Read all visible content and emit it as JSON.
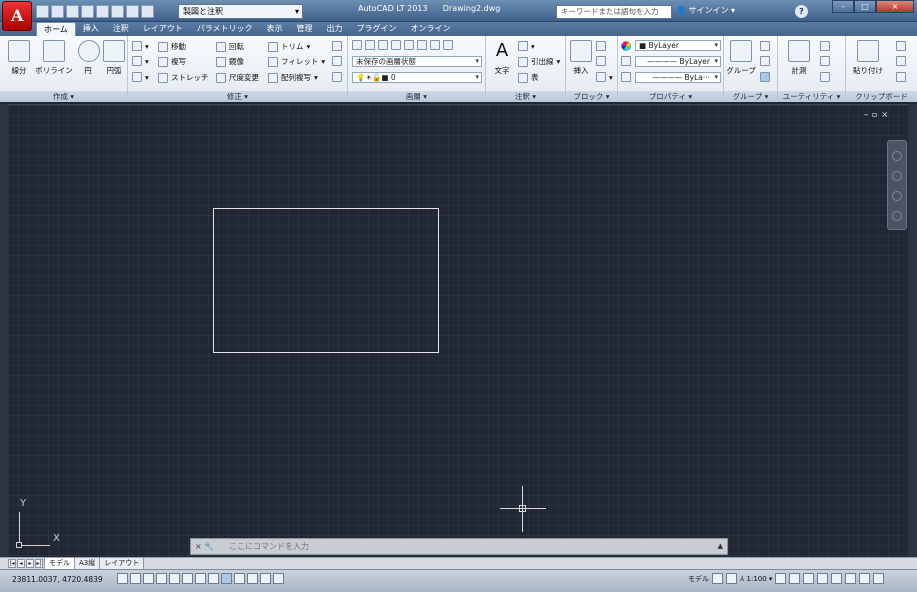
{
  "app": {
    "title": "AutoCAD LT 2013",
    "document": "Drawing2.dwg",
    "app_menu_letter": "A"
  },
  "workspace": {
    "value": "製図と注釈"
  },
  "search": {
    "placeholder": "キーワードまたは語句を入力"
  },
  "signin": {
    "label": "サインイン"
  },
  "help": {
    "label": "?"
  },
  "window_controls": {
    "minimize": "–",
    "maximize": "□",
    "close": "×"
  },
  "tabs": [
    "ホーム",
    "挿入",
    "注釈",
    "レイアウト",
    "パラメトリック",
    "表示",
    "管理",
    "出力",
    "プラグイン",
    "オンライン"
  ],
  "ribbon": {
    "draw": {
      "title": "作成 ▾",
      "line": "線分",
      "polyline": "ポリライン",
      "circle": "円",
      "arc": "円弧"
    },
    "modify": {
      "title": "修正 ▾",
      "move": "移動",
      "rotate": "回転",
      "trim": "トリム",
      "copy": "複写",
      "mirror": "鏡像",
      "fillet": "フィレット",
      "stretch": "ストレッチ",
      "scale": "尺度変更",
      "array": "配列複写"
    },
    "layers": {
      "title": "画層 ▾",
      "state": "未保存の画層状態",
      "current": "0"
    },
    "annotation": {
      "title": "注釈 ▾",
      "text": "文字",
      "leader": "引出線",
      "table": "表"
    },
    "block": {
      "title": "ブロック ▾",
      "insert": "挿入"
    },
    "properties": {
      "title": "プロパティ ▾",
      "color": "ByLayer",
      "linetype": "ByLayer",
      "lineweight": "ByLa···"
    },
    "groups": {
      "title": "グループ ▾",
      "group": "グループ"
    },
    "utilities": {
      "title": "ユーティリティ ▾",
      "measure": "計測"
    },
    "clipboard": {
      "title": "クリップボード",
      "paste": "貼り付け"
    }
  },
  "axis": {
    "x": "X",
    "y": "Y"
  },
  "command": {
    "placeholder": "ここにコマンドを入力",
    "controls": "× 🔧"
  },
  "layout_tabs": [
    "モデル",
    "A3縦",
    "レイアウト"
  ],
  "status": {
    "coordinates": "23811.0037, 4720.4839",
    "model": "モデル",
    "scale": "1:100"
  }
}
